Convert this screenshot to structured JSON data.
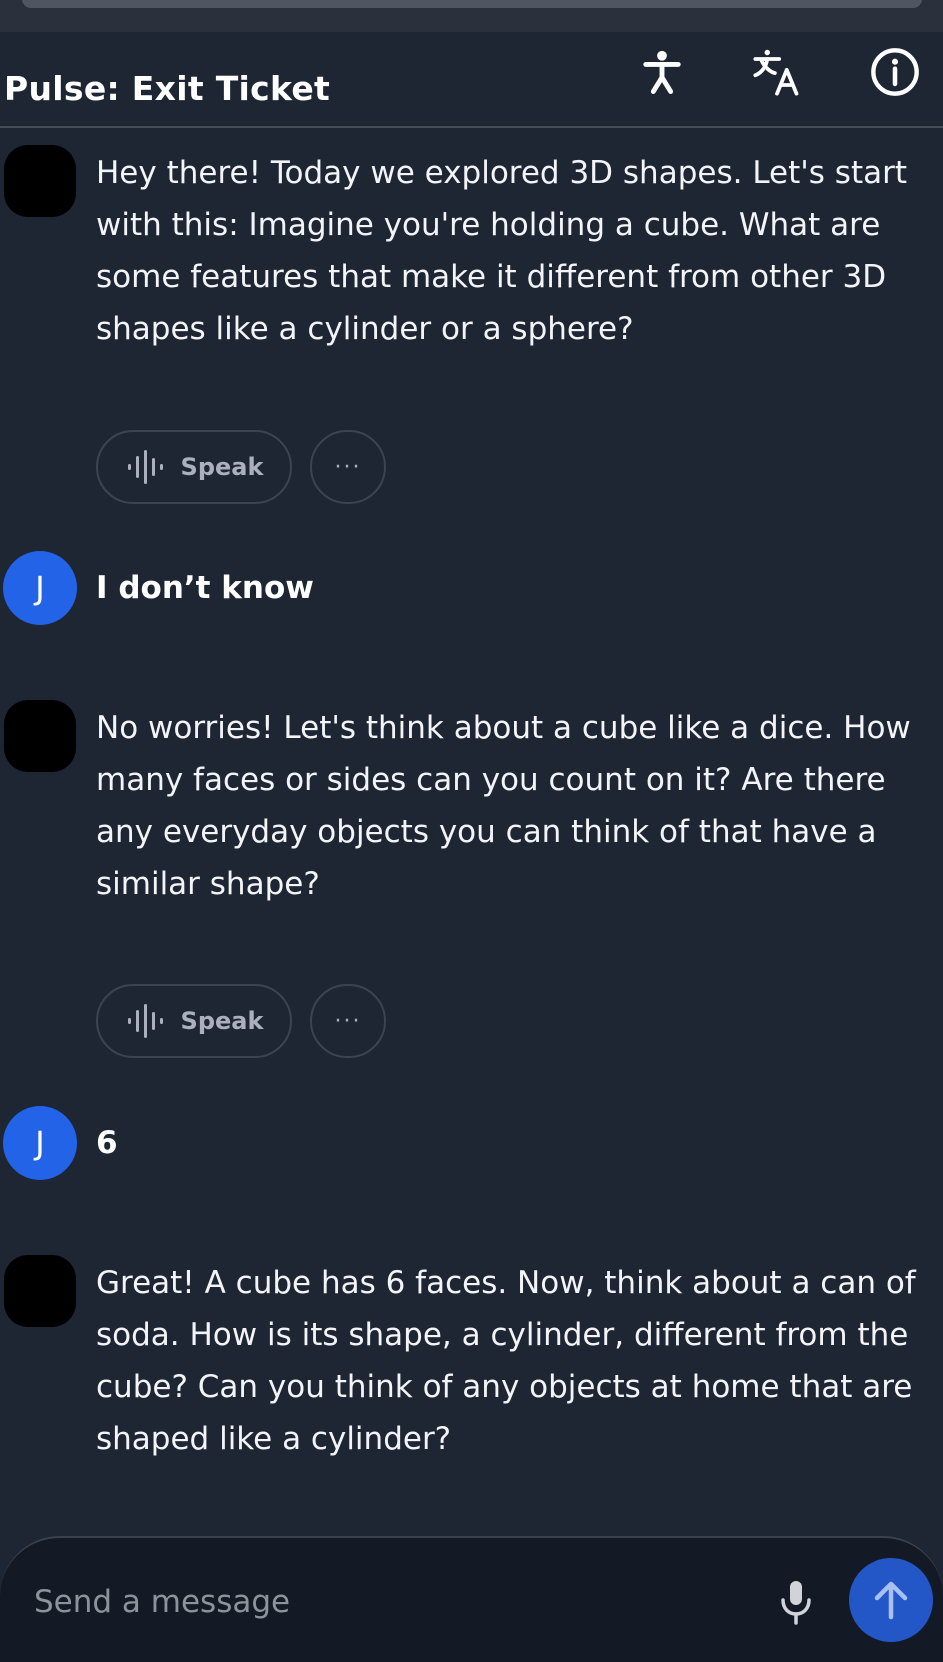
{
  "header": {
    "title": "Pulse: Exit Ticket",
    "icons": [
      "accessibility-icon",
      "translate-icon",
      "info-icon"
    ]
  },
  "messages": [
    {
      "role": "assistant",
      "text": "Hey there! Today we explored 3D shapes. Let's start with this: Imagine you're holding a cube. What are some features that make it different from other 3D shapes like a cylinder or a sphere?",
      "speak_label": "Speak",
      "more_label": "···"
    },
    {
      "role": "user",
      "avatar_initial": "J",
      "text": "I don’t know"
    },
    {
      "role": "assistant",
      "text": "No worries! Let's think about a cube like a dice. How many faces or sides can you count on it? Are there any everyday objects you can think of that have a similar shape?",
      "speak_label": "Speak",
      "more_label": "···"
    },
    {
      "role": "user",
      "avatar_initial": "J",
      "text": "6"
    },
    {
      "role": "assistant",
      "text": "Great! A cube has 6 faces. Now, think about a can of soda. How is its shape, a cylinder, different from the cube? Can you think of any objects at home that are shaped like a cylinder?"
    }
  ],
  "composer": {
    "placeholder": "Send a message",
    "value": ""
  },
  "colors": {
    "background": "#1f2633",
    "user_avatar": "#2363e8",
    "send_button": "#2356c7",
    "assistant_avatar": "#000000"
  }
}
